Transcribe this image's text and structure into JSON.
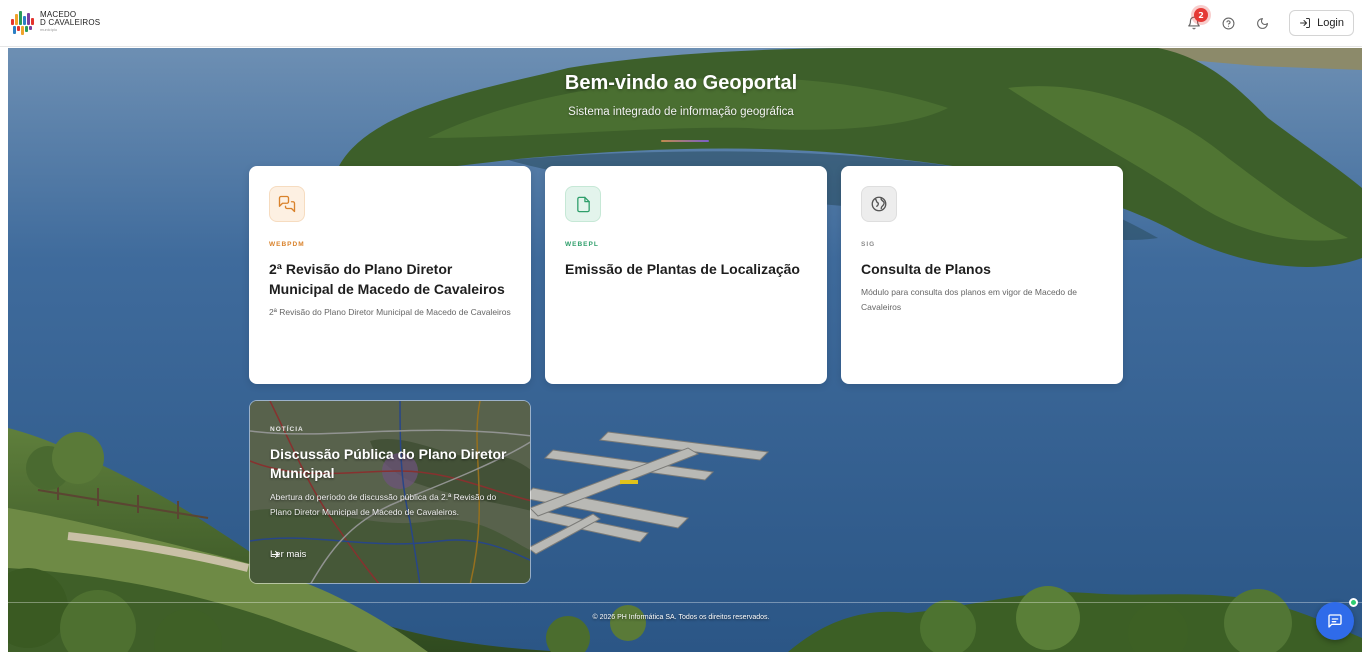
{
  "header": {
    "logo": {
      "line1": "MACEDO",
      "line2": "D CAVALEIROS",
      "line3": "município"
    },
    "notifications": {
      "count": "2",
      "icon": "bell-icon"
    },
    "help_icon": "help-circle-icon",
    "theme_icon": "moon-icon",
    "login_label": "Login",
    "login_icon": "login-icon"
  },
  "hero": {
    "title": "Bem-vindo ao Geoportal",
    "subtitle": "Sistema integrado de informação geográfica"
  },
  "cards": [
    {
      "tag": "WEBPDM",
      "tag_color": "#d9822b",
      "icon": "chat-bubbles-icon",
      "icon_bg": "#fdf0e2",
      "icon_color": "#d9822b",
      "title": "2ª Revisão do Plano Diretor Municipal de Macedo de Cavaleiros",
      "description": "2ª Revisão do Plano Diretor Municipal de Macedo de Cavaleiros"
    },
    {
      "tag": "WEBEPL",
      "tag_color": "#2e9e6a",
      "icon": "document-icon",
      "icon_bg": "#e3f4ec",
      "icon_color": "#2e9e6a",
      "title": "Emissão de Plantas de Localização",
      "description": ""
    },
    {
      "tag": "SIG",
      "tag_color": "#8a8a8a",
      "icon": "map-globe-icon",
      "icon_bg": "#ededed",
      "icon_color": "#555555",
      "title": "Consulta de Planos",
      "description": "Módulo para consulta dos planos em vigor de Macedo de Cavaleiros"
    }
  ],
  "news": {
    "tag": "NOTÍCIA",
    "title": "Discussão Pública do Plano Diretor Municipal",
    "description": "Abertura do período de discussão pública da 2.ª Revisão do Plano Diretor Municipal de Macedo de Cavaleiros.",
    "more_label": "Ler mais",
    "more_icon": "arrow-right-icon"
  },
  "footer": {
    "text": "© 2026 PH Informática SA. Todos os direitos reservados."
  },
  "chat": {
    "icon": "chat-icon"
  }
}
